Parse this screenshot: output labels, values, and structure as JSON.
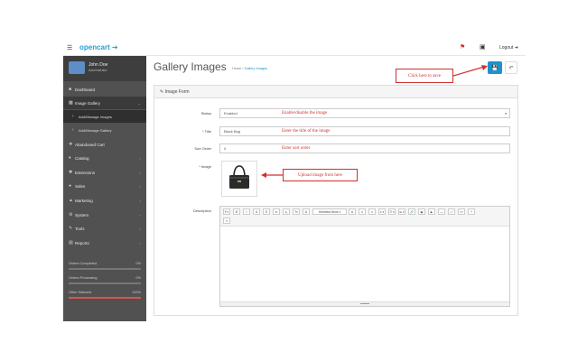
{
  "header": {
    "logo_text": "opencart",
    "logo_icon": "cart-icon",
    "logout_label": "Logout",
    "icons": [
      "bars-icon",
      "bell-icon",
      "home-icon",
      "logout-icon"
    ]
  },
  "user": {
    "name": "John Doe",
    "role": "Administrator"
  },
  "sidebar": {
    "items": [
      {
        "label": "Dashboard",
        "icon": "dashboard-icon"
      },
      {
        "label": "Image Gallery",
        "icon": "image-icon"
      },
      {
        "label": "Add/Manage Images",
        "icon": "bullet-icon"
      },
      {
        "label": "Add/Manage Gallery",
        "icon": "bullet-icon"
      },
      {
        "label": "Abandoned Cart",
        "icon": "cart-icon"
      },
      {
        "label": "Catalog",
        "icon": "tag-icon"
      },
      {
        "label": "Extensions",
        "icon": "puzzle-icon"
      },
      {
        "label": "Sales",
        "icon": "cart-icon"
      },
      {
        "label": "Marketing",
        "icon": "share-icon"
      },
      {
        "label": "System",
        "icon": "gear-icon"
      },
      {
        "label": "Tools",
        "icon": "wrench-icon"
      },
      {
        "label": "Reports",
        "icon": "chart-icon"
      }
    ],
    "stats": [
      {
        "label": "Orders Completed",
        "value": "0%",
        "level": 0,
        "color": "#cccccc"
      },
      {
        "label": "Orders Processing",
        "value": "0%",
        "level": 0,
        "color": "#cccccc"
      },
      {
        "label": "Other Statuses",
        "value": "100%",
        "level": 1.0,
        "color": "#d9534f"
      }
    ]
  },
  "page": {
    "title": "Gallery Images",
    "breadcrumb": {
      "home": "Home",
      "separator": " › ",
      "current": "Gallery Images"
    },
    "save_icon": "save-icon",
    "back_icon": "reply-icon"
  },
  "panel": {
    "title": "Image Form",
    "title_icon": "pencil-icon"
  },
  "form": {
    "status": {
      "label": "Status",
      "value": "Enabled"
    },
    "title": {
      "label": "Title",
      "value": "Black Bag"
    },
    "sort_order": {
      "label": "Sort Order",
      "value": "0"
    },
    "image": {
      "label": "Image"
    },
    "description": {
      "label": "Description"
    }
  },
  "annotations": {
    "save": "Click here to save",
    "status": "Enable/disable the image",
    "title": "Enter the title of the image",
    "sort": "Enter sort order",
    "upload": "Upload image from here"
  },
  "editor": {
    "toolbar_row1": [
      "¶ ▾",
      "B",
      "I",
      "U",
      "S",
      "x²",
      "x₂",
      "Tx",
      "A",
      "Helvetica Neue ▾",
      "A",
      "≡",
      "≡",
      "≡ ▾",
      "☰ ▾",
      "⊞ ▾",
      "🔗",
      "▣",
      "▶",
      "―",
      "⤢",
      "<>",
      "?"
    ],
    "toolbar_row2": [
      "▾"
    ]
  },
  "colors": {
    "accent": "#1e91cf",
    "annotation": "#d32f2f",
    "sidebar": "#515151"
  }
}
